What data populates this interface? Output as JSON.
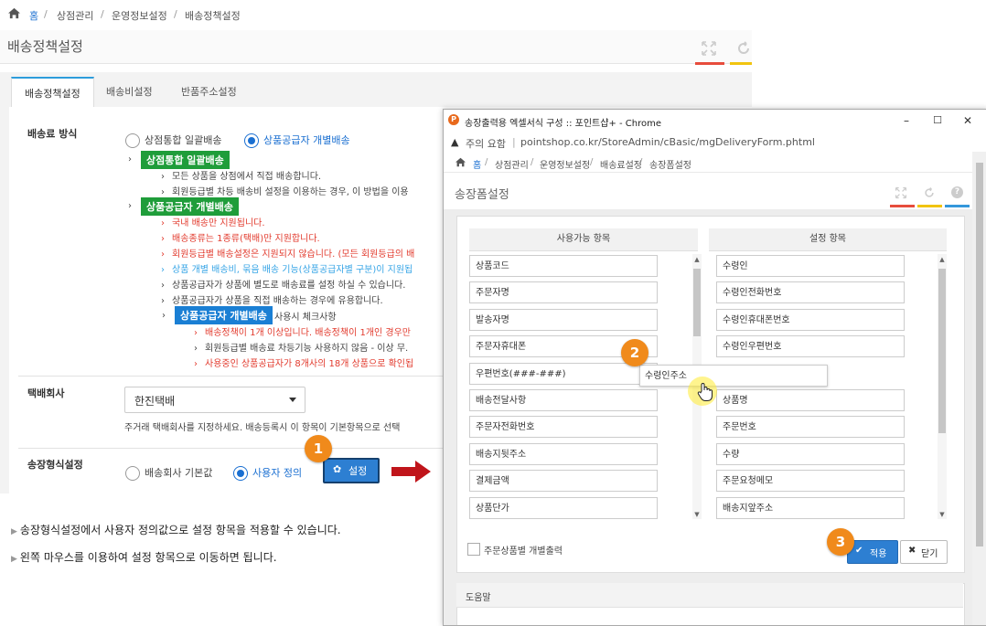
{
  "breadcrumb": {
    "home": "홈",
    "items": [
      "상점관리",
      "운영정보설정",
      "배송정책설정"
    ],
    "sep": "/"
  },
  "page_title": "배송정책설정",
  "tabs": [
    {
      "label": "배송정책설정",
      "active": true
    },
    {
      "label": "배송비설정"
    },
    {
      "label": "반품주소설정"
    }
  ],
  "shipping_method": {
    "label": "배송료 방식",
    "options": [
      {
        "label": "상점통합 일괄배송",
        "selected": false
      },
      {
        "label": "상품공급자 개별배송",
        "selected": true
      }
    ],
    "badge_integrated": "상점통합 일괄배송",
    "integrated_notes": [
      "모든 상품을 상점에서 직접 배송합니다.",
      "회원등급별 차등 배송비 설정을 이용하는 경우, 이 방법을 이용"
    ],
    "badge_individual": "상품공급자 개별배송",
    "individual_notes": [
      {
        "text": "국내 배송만 지원됩니다.",
        "color": "red"
      },
      {
        "text": "배송종류는 1종류(택배)만 지원합니다.",
        "color": "red"
      },
      {
        "text": "회원등급별 배송설정은 지원되지 않습니다. (모든 회원등급의 배",
        "color": "red"
      },
      {
        "text": "상품 개별 배송비, 묶음 배송 기능(상품공급자별 구분)이 지원됩",
        "color": "blue"
      },
      {
        "text": "상품공급자가 상품에 별도로 배송료를 설정 하실 수 있습니다.",
        "color": "dark"
      },
      {
        "text": "상품공급자가 상품을 직접 배송하는 경우에 유용합니다.",
        "color": "dark"
      }
    ],
    "badge_individual_check": "상품공급자 개별배송",
    "check_suffix": "사용시 체크사항",
    "check_notes": [
      {
        "text": "배송정책이 1개 이상입니다. 배송정책이 1개인 경우만",
        "color": "red"
      },
      {
        "text": "회원등급별 배송료 차등기능 사용하지 않음 - 이상 무.",
        "color": "dark"
      },
      {
        "text": "사용중인 상품공급자가 8개사의 18개 상품으로 확인됩",
        "color": "red"
      }
    ]
  },
  "courier": {
    "label": "택배회사",
    "value": "한진택배",
    "help": "주거래 택배회사를 지정하세요. 배송등록시 이 항목이 기본항목으로 선택"
  },
  "invoice_format": {
    "label": "송장형식설정",
    "options": [
      {
        "label": "배송회사 기본값",
        "selected": false
      },
      {
        "label": "사용자 정의",
        "selected": true
      }
    ],
    "button": "설정"
  },
  "step_badges": [
    "1",
    "2",
    "3"
  ],
  "notes": [
    "송장형식설정에서 사용자 정의값으로 설정 항목을 적용할 수 있습니다.",
    "왼쪽 마우스를 이용하여 설정 항목으로 이동하면 됩니다."
  ],
  "popup": {
    "window_title": "송장출력용 엑셀서식 구성 :: 포인트샵+ - Chrome",
    "window_buttons": [
      "–",
      "☐",
      "✕"
    ],
    "security_label": "주의 요함",
    "url": "pointshop.co.kr/StoreAdmin/cBasic/mgDeliveryForm.phtml",
    "breadcrumb": {
      "home": "홈",
      "items": [
        "상점관리",
        "운영정보설정",
        "배송료설정",
        "송장폼설정"
      ]
    },
    "title": "송장폼설정",
    "available_header": "사용가능 항목",
    "selected_header": "설정 항목",
    "available_items": [
      "상품코드",
      "주문자명",
      "발송자명",
      "주문자휴대폰",
      "우편번호(###-###)",
      "배송전달사항",
      "주문자전화번호",
      "배송지뒷주소",
      "결제금액",
      "상품단가"
    ],
    "selected_items": [
      "수령인",
      "수령인전화번호",
      "수령인휴대폰번호",
      "수령인우편번호",
      "",
      "상품명",
      "주문번호",
      "수량",
      "주문요청메모",
      "배송지앞주소"
    ],
    "dragging_item": "수령인주소",
    "checkbox_label": "주문상품별 개별출력",
    "apply_button": "적용",
    "close_button": "닫기",
    "help_title": "도움말"
  },
  "colors": {
    "accent": "#2d7fd2",
    "badge_green": "#1f9d3a",
    "badge_blue": "#1a7fd4",
    "step_orange": "#f08a1b",
    "red_text": "#e23b2e",
    "blue_text": "#35a4e6"
  }
}
